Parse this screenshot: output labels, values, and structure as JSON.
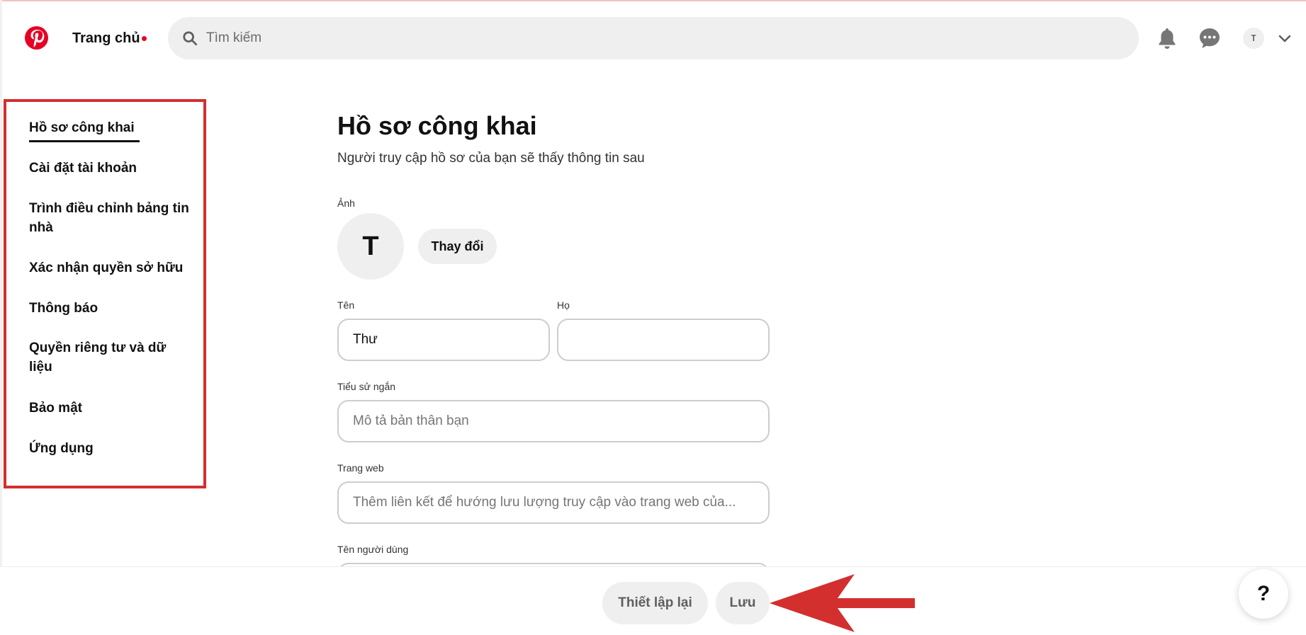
{
  "header": {
    "home_label": "Trang chủ",
    "search_placeholder": "Tìm kiếm",
    "avatar_initial": "T",
    "icons": [
      "pinterest-logo-icon",
      "search-icon",
      "bell-icon",
      "chat-icon",
      "chevron-down-icon"
    ],
    "brand_color": "#e60023"
  },
  "sidebar": {
    "items": [
      {
        "label": "Hồ sơ công khai",
        "active": true
      },
      {
        "label": "Cài đặt tài khoản"
      },
      {
        "label": "Trình điều chỉnh bảng tin nhà"
      },
      {
        "label": "Xác nhận quyền sở hữu"
      },
      {
        "label": "Thông báo"
      },
      {
        "label": "Quyền riêng tư và dữ liệu"
      },
      {
        "label": "Bảo mật"
      },
      {
        "label": "Ứng dụng"
      }
    ],
    "highlight_color": "#d32f2f"
  },
  "main": {
    "title": "Hồ sơ công khai",
    "subtitle": "Người truy cập hồ sơ của bạn sẽ thấy thông tin sau",
    "photo_label": "Ảnh",
    "avatar_initial": "T",
    "change_label": "Thay đổi",
    "first_name_label": "Tên",
    "first_name_value": "Thư",
    "last_name_label": "Họ",
    "last_name_value": "",
    "bio_label": "Tiểu sử ngắn",
    "bio_placeholder": "Mô tả bản thân bạn",
    "website_label": "Trang web",
    "website_placeholder": "Thêm liên kết để hướng lưu lượng truy cập vào trang web của...",
    "username_label": "Tên người dùng"
  },
  "footer": {
    "reset_label": "Thiết lập lại",
    "save_label": "Lưu",
    "help_label": "?",
    "arrow_color": "#d32f2f"
  }
}
